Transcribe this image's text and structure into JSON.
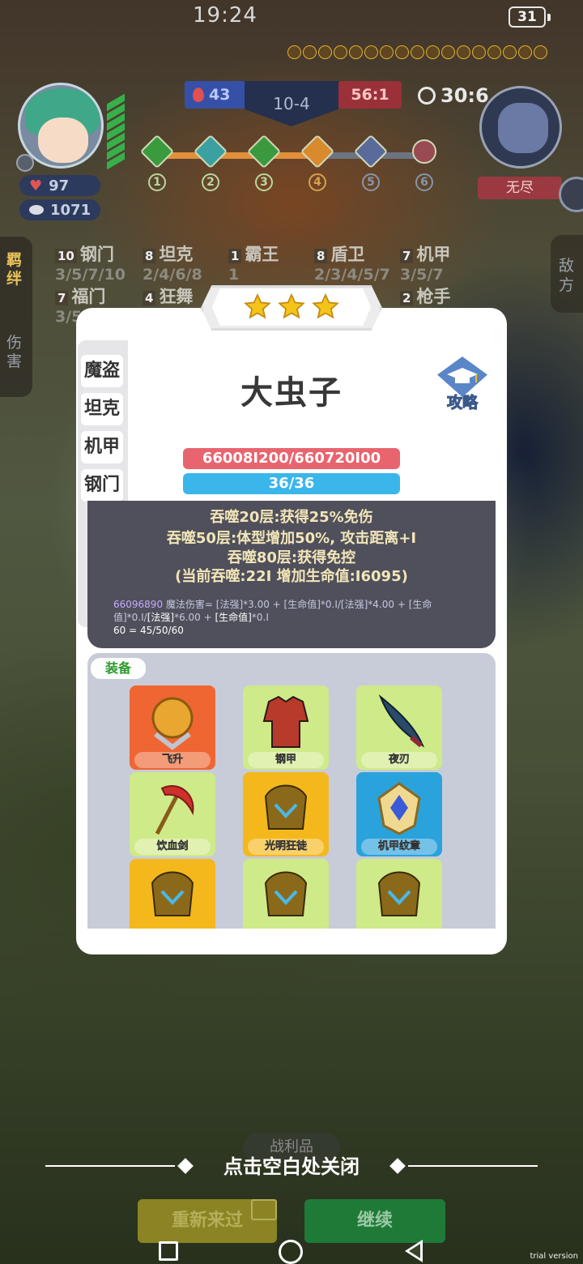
{
  "status_bar": {
    "time": "19:24",
    "battery": "31"
  },
  "hud": {
    "blue_score": "43",
    "round": "10-4",
    "red_score": "56:1",
    "timer": "30:6",
    "player_hp": "97",
    "player_gold": "1071",
    "opponent_name": "无尽",
    "stages": [
      "1",
      "2",
      "3",
      "4",
      "5",
      "6"
    ]
  },
  "synergy_tabs": {
    "bonds": "羁绊",
    "damage": "伤害",
    "enemy": "敌方"
  },
  "synergies": [
    {
      "count": "10",
      "name": "钢门",
      "levels": "3/5/7/10"
    },
    {
      "count": "8",
      "name": "坦克",
      "levels": "2/4/6/8"
    },
    {
      "count": "1",
      "name": "霸王",
      "levels": "1"
    },
    {
      "count": "8",
      "name": "盾卫",
      "levels": "2/3/4/5/7"
    },
    {
      "count": "7",
      "name": "机甲",
      "levels": "3/5/7"
    },
    {
      "count": "7",
      "name": "福门",
      "levels": "3/5"
    },
    {
      "count": "4",
      "name": "狂舞",
      "levels": ""
    },
    {
      "count": "2",
      "name": "枪手",
      "levels": ""
    }
  ],
  "hero": {
    "name": "大虫子",
    "stars": 3,
    "guide_label": "攻略",
    "hp": "66008I200/660720I00",
    "mana": "36/36",
    "trait_tabs": [
      "魔盗",
      "坦克",
      "机甲",
      "钢门",
      "",
      "",
      ""
    ],
    "desc_lines": [
      "吞噬20层:获得25%免伤",
      "吞噬50层:体型增加50%, 攻击距离+I",
      "吞噬80层:获得免控",
      "(当前吞噬:22I 增加生命值:I6095)"
    ],
    "formula_num": "66096890",
    "formula_a": "魔法伤害= [法强]*3.00 + [生命值]*0.I/[法强]*4.00 + [生命值]*0.I/",
    "formula_b": "[法强]",
    "formula_c": "*6.00 + ",
    "formula_d": "[生命值]",
    "formula_e": "*0.I",
    "formula_f": "60 = 45/50/60"
  },
  "equipment": {
    "tab_label": "装备",
    "items": [
      {
        "name": "飞升",
        "color": "#ef6632"
      },
      {
        "name": "钢甲",
        "color": "#cfea88"
      },
      {
        "name": "夜刃",
        "color": "#cfea88"
      },
      {
        "name": "饮血剑",
        "color": "#cfea88"
      },
      {
        "name": "光明狂徒",
        "color": "#f4b81c"
      },
      {
        "name": "机甲纹章",
        "color": "#2aa2dc"
      },
      {
        "name": "",
        "color": "#f4b81c"
      },
      {
        "name": "",
        "color": "#cfea88"
      },
      {
        "name": "",
        "color": "#cfea88"
      }
    ]
  },
  "footer": {
    "close_hint": "点击空白处关闭",
    "loot_label": "战利品",
    "retry_label": "重新来过",
    "continue_label": "继续"
  },
  "watermark": "trial version",
  "colors": {
    "hp_bar": "#e8646e",
    "mana_bar": "#3ab6ea",
    "desc_text": "#f2e6b8",
    "equip_tag": "#2a9a2a"
  }
}
